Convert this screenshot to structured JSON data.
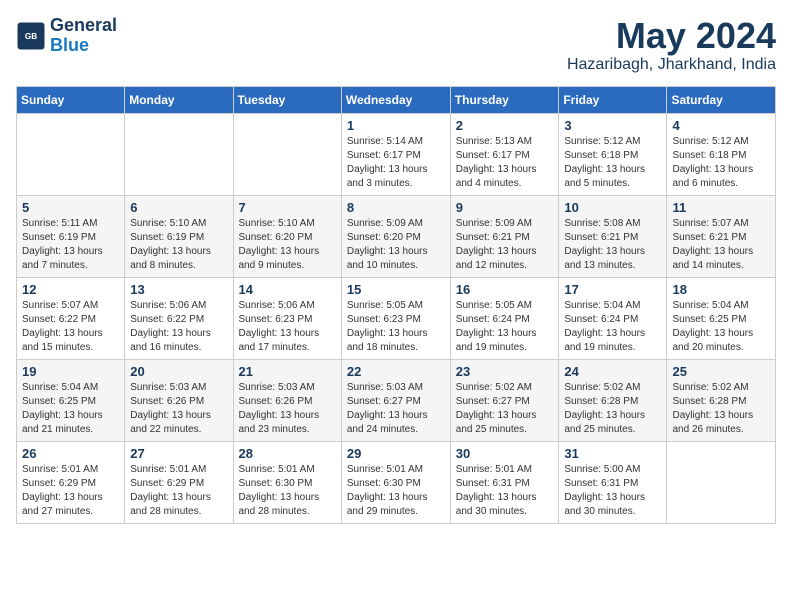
{
  "logo": {
    "line1": "General",
    "line2": "Blue"
  },
  "title": "May 2024",
  "location": "Hazaribagh, Jharkhand, India",
  "days_of_week": [
    "Sunday",
    "Monday",
    "Tuesday",
    "Wednesday",
    "Thursday",
    "Friday",
    "Saturday"
  ],
  "weeks": [
    [
      {
        "day": "",
        "info": ""
      },
      {
        "day": "",
        "info": ""
      },
      {
        "day": "",
        "info": ""
      },
      {
        "day": "1",
        "info": "Sunrise: 5:14 AM\nSunset: 6:17 PM\nDaylight: 13 hours and 3 minutes."
      },
      {
        "day": "2",
        "info": "Sunrise: 5:13 AM\nSunset: 6:17 PM\nDaylight: 13 hours and 4 minutes."
      },
      {
        "day": "3",
        "info": "Sunrise: 5:12 AM\nSunset: 6:18 PM\nDaylight: 13 hours and 5 minutes."
      },
      {
        "day": "4",
        "info": "Sunrise: 5:12 AM\nSunset: 6:18 PM\nDaylight: 13 hours and 6 minutes."
      }
    ],
    [
      {
        "day": "5",
        "info": "Sunrise: 5:11 AM\nSunset: 6:19 PM\nDaylight: 13 hours and 7 minutes."
      },
      {
        "day": "6",
        "info": "Sunrise: 5:10 AM\nSunset: 6:19 PM\nDaylight: 13 hours and 8 minutes."
      },
      {
        "day": "7",
        "info": "Sunrise: 5:10 AM\nSunset: 6:20 PM\nDaylight: 13 hours and 9 minutes."
      },
      {
        "day": "8",
        "info": "Sunrise: 5:09 AM\nSunset: 6:20 PM\nDaylight: 13 hours and 10 minutes."
      },
      {
        "day": "9",
        "info": "Sunrise: 5:09 AM\nSunset: 6:21 PM\nDaylight: 13 hours and 12 minutes."
      },
      {
        "day": "10",
        "info": "Sunrise: 5:08 AM\nSunset: 6:21 PM\nDaylight: 13 hours and 13 minutes."
      },
      {
        "day": "11",
        "info": "Sunrise: 5:07 AM\nSunset: 6:21 PM\nDaylight: 13 hours and 14 minutes."
      }
    ],
    [
      {
        "day": "12",
        "info": "Sunrise: 5:07 AM\nSunset: 6:22 PM\nDaylight: 13 hours and 15 minutes."
      },
      {
        "day": "13",
        "info": "Sunrise: 5:06 AM\nSunset: 6:22 PM\nDaylight: 13 hours and 16 minutes."
      },
      {
        "day": "14",
        "info": "Sunrise: 5:06 AM\nSunset: 6:23 PM\nDaylight: 13 hours and 17 minutes."
      },
      {
        "day": "15",
        "info": "Sunrise: 5:05 AM\nSunset: 6:23 PM\nDaylight: 13 hours and 18 minutes."
      },
      {
        "day": "16",
        "info": "Sunrise: 5:05 AM\nSunset: 6:24 PM\nDaylight: 13 hours and 19 minutes."
      },
      {
        "day": "17",
        "info": "Sunrise: 5:04 AM\nSunset: 6:24 PM\nDaylight: 13 hours and 19 minutes."
      },
      {
        "day": "18",
        "info": "Sunrise: 5:04 AM\nSunset: 6:25 PM\nDaylight: 13 hours and 20 minutes."
      }
    ],
    [
      {
        "day": "19",
        "info": "Sunrise: 5:04 AM\nSunset: 6:25 PM\nDaylight: 13 hours and 21 minutes."
      },
      {
        "day": "20",
        "info": "Sunrise: 5:03 AM\nSunset: 6:26 PM\nDaylight: 13 hours and 22 minutes."
      },
      {
        "day": "21",
        "info": "Sunrise: 5:03 AM\nSunset: 6:26 PM\nDaylight: 13 hours and 23 minutes."
      },
      {
        "day": "22",
        "info": "Sunrise: 5:03 AM\nSunset: 6:27 PM\nDaylight: 13 hours and 24 minutes."
      },
      {
        "day": "23",
        "info": "Sunrise: 5:02 AM\nSunset: 6:27 PM\nDaylight: 13 hours and 25 minutes."
      },
      {
        "day": "24",
        "info": "Sunrise: 5:02 AM\nSunset: 6:28 PM\nDaylight: 13 hours and 25 minutes."
      },
      {
        "day": "25",
        "info": "Sunrise: 5:02 AM\nSunset: 6:28 PM\nDaylight: 13 hours and 26 minutes."
      }
    ],
    [
      {
        "day": "26",
        "info": "Sunrise: 5:01 AM\nSunset: 6:29 PM\nDaylight: 13 hours and 27 minutes."
      },
      {
        "day": "27",
        "info": "Sunrise: 5:01 AM\nSunset: 6:29 PM\nDaylight: 13 hours and 28 minutes."
      },
      {
        "day": "28",
        "info": "Sunrise: 5:01 AM\nSunset: 6:30 PM\nDaylight: 13 hours and 28 minutes."
      },
      {
        "day": "29",
        "info": "Sunrise: 5:01 AM\nSunset: 6:30 PM\nDaylight: 13 hours and 29 minutes."
      },
      {
        "day": "30",
        "info": "Sunrise: 5:01 AM\nSunset: 6:31 PM\nDaylight: 13 hours and 30 minutes."
      },
      {
        "day": "31",
        "info": "Sunrise: 5:00 AM\nSunset: 6:31 PM\nDaylight: 13 hours and 30 minutes."
      },
      {
        "day": "",
        "info": ""
      }
    ]
  ]
}
